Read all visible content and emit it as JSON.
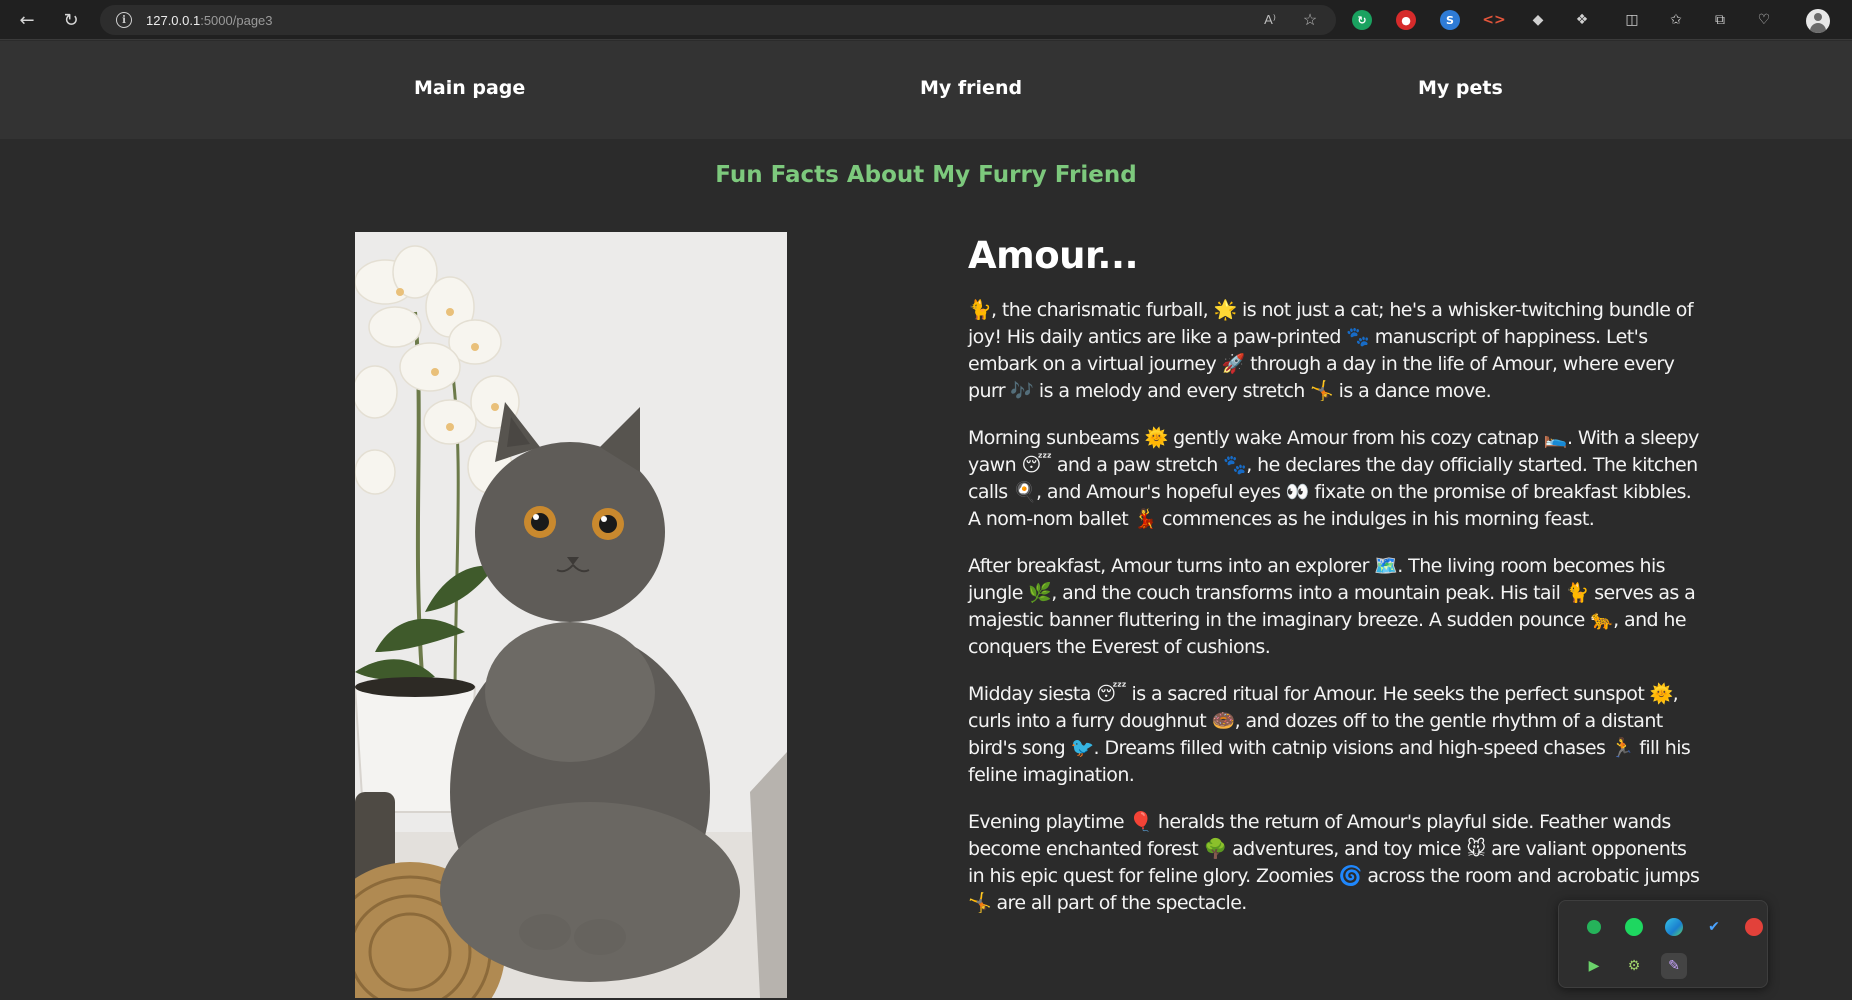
{
  "browser": {
    "url_host": "127.0.0.1",
    "url_path": ":5000/page3",
    "read_aloud_label": "A⁾"
  },
  "nav": {
    "items": [
      {
        "label": "Main page"
      },
      {
        "label": "My friend"
      },
      {
        "label": "My pets"
      }
    ]
  },
  "page_title": "Fun Facts About My Furry Friend",
  "article": {
    "heading": "Amour...",
    "paragraphs": [
      "🐈, the charismatic furball, 🌟 is not just a cat; he's a whisker-twitching bundle of joy! His daily antics are like a paw-printed 🐾 manuscript of happiness. Let's embark on a virtual journey 🚀 through a day in the life of Amour, where every purr 🎶 is a melody and every stretch 🤸 is a dance move.",
      "Morning sunbeams 🌞 gently wake Amour from his cozy catnap 🛌. With a sleepy yawn 😴 and a paw stretch 🐾, he declares the day officially started. The kitchen calls 🍳, and Amour's hopeful eyes 👀 fixate on the promise of breakfast kibbles. A nom-nom ballet 💃 commences as he indulges in his morning feast.",
      "After breakfast, Amour turns into an explorer 🗺️. The living room becomes his jungle 🌿, and the couch transforms into a mountain peak. His tail 🐈 serves as a majestic banner fluttering in the imaginary breeze. A sudden pounce 🐆, and he conquers the Everest of cushions.",
      "Midday siesta 😴 is a sacred ritual for Amour. He seeks the perfect sunspot 🌞, curls into a furry doughnut 🍩, and dozes off to the gentle rhythm of a distant bird's song 🐦. Dreams filled with catnip visions and high-speed chases 🏃 fill his feline imagination.",
      "Evening playtime 🎈 heralds the return of Amour's playful side. Feather wands become enchanted forest 🌳 adventures, and toy mice 🐭 are valiant opponents in his epic quest for feline glory. Zoomies 🌀 across the room and acrobatic jumps 🤸 are all part of the spectacle."
    ]
  },
  "image": {
    "subject": "gray long-haired cat sitting beside white orchids"
  },
  "icons": {
    "back": "back-arrow-icon",
    "reload": "reload-icon",
    "info": "site-info-icon",
    "favorite": "star-icon"
  },
  "colors": {
    "title_green": "#7dc97d",
    "page_bg": "#2b2b2b",
    "nav_bg": "#333333"
  }
}
